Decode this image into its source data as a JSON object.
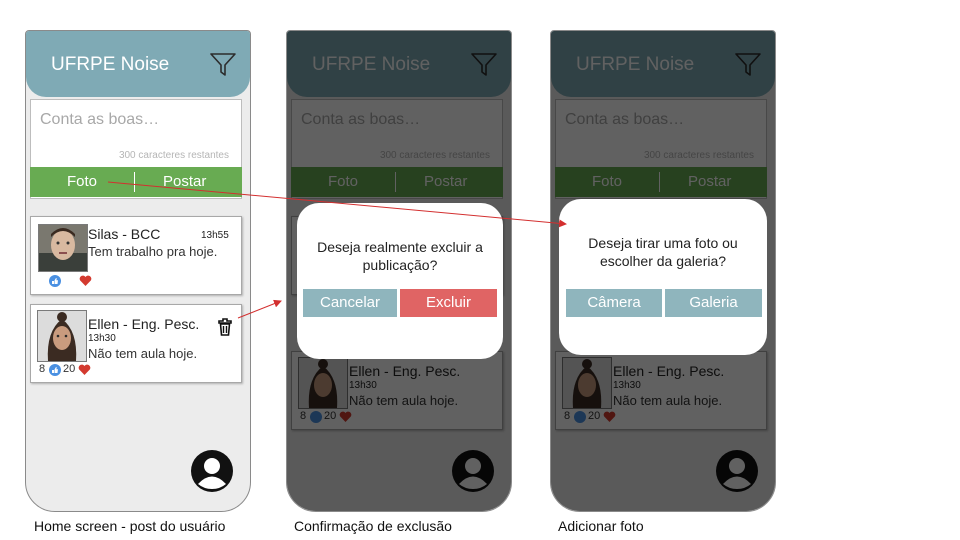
{
  "app": {
    "title": "UFRPE Noise",
    "composer_placeholder": "Conta as boas…",
    "char_counter": "300 caracteres restantes",
    "photo_label": "Foto",
    "post_label": "Postar"
  },
  "posts": [
    {
      "author": "Silas - BCC",
      "time": "13h55",
      "text": "Tem trabalho pra hoje.",
      "avatar": "mr-bean-photo"
    },
    {
      "author": "Ellen - Eng. Pesc.",
      "time": "13h30",
      "text": "Não tem aula hoje.",
      "likes": "8",
      "hearts": "20",
      "avatar": "woman-photo"
    }
  ],
  "dialogs": {
    "delete": {
      "question_line1": "Deseja realmente excluir a",
      "question_line2": "publicação?",
      "cancel": "Cancelar",
      "confirm": "Excluir"
    },
    "photo": {
      "question_line1": "Deseja tirar uma foto ou",
      "question_line2": "escolher da galeria?",
      "camera": "Câmera",
      "gallery": "Galeria"
    }
  },
  "captions": [
    "Home screen - post do usuário",
    "Confirmação de exclusão",
    "Adicionar foto"
  ],
  "colors": {
    "header": "#7faab5",
    "post_bar": "#68ab52",
    "cancel": "#8fb5bd",
    "delete": "#e06464",
    "arrow": "#d32f2f",
    "like": "#4a90e2",
    "heart": "#d33a2f"
  }
}
